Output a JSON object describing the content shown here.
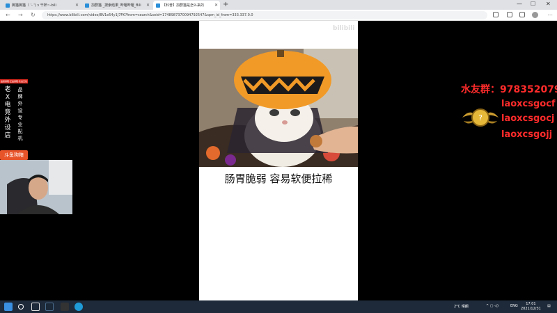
{
  "browser": {
    "tabs": [
      {
        "label": "御猫御猫（ '- ') ɔ 干杯~-bili"
      },
      {
        "label": "加群猫 _搜索结果_哔哩哔哩_Bili"
      },
      {
        "label": "【科普】加群猫是怎么来的"
      }
    ],
    "url": "https://www.bilibili.com/video/BV1e54y1J7FK?from=search&seid=1748987370094792547&spm_id_from=333.337.0.0"
  },
  "video": {
    "watermark": "bilibili",
    "subtitle": "肠胃脆弱 容易软便拉稀"
  },
  "left_ad": {
    "top_text": "品质保障·正品保障·售后无忧",
    "col1": [
      "老",
      "X",
      "电",
      "竞",
      "外",
      "设",
      "店"
    ],
    "col2": [
      "品",
      "牌",
      "外",
      "设",
      "专",
      "业",
      "配",
      "机"
    ],
    "bottom_text": "斗鱼狗粮"
  },
  "overlay": {
    "qq_group": "水友群：978352079",
    "lines": [
      "laoxcsgocf",
      "laoxcsgocj",
      "laoxcsgojj"
    ]
  },
  "taskbar": {
    "weather": "2°C 晴朗",
    "lang": "ENG",
    "time": "17:01",
    "date": "2021/12/31"
  }
}
